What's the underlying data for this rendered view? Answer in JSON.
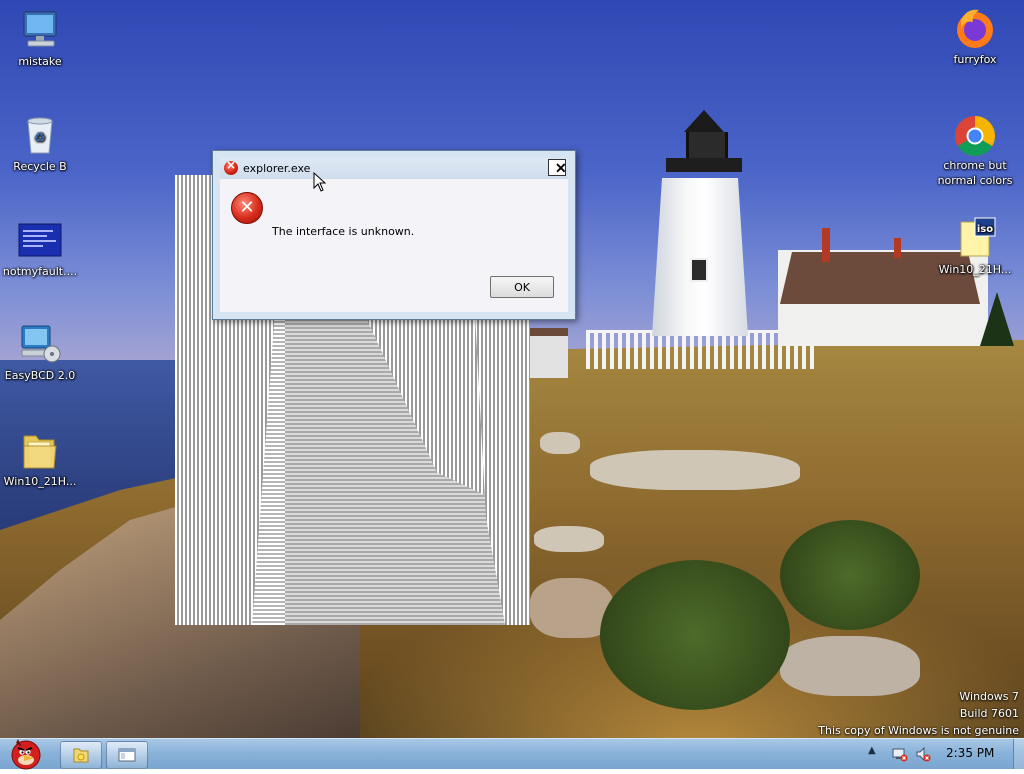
{
  "desktop": {
    "icons_left": [
      {
        "label": "mistake",
        "icon": "computer-icon"
      },
      {
        "label": "Recycle B",
        "icon": "recycle-bin-icon"
      },
      {
        "label": "notmyfault....",
        "icon": "bsod-thumbnail-icon"
      },
      {
        "label": "EasyBCD 2.0",
        "icon": "easybcd-icon"
      },
      {
        "label": "Win10_21H...",
        "icon": "folder-icon"
      }
    ],
    "icons_right": [
      {
        "label": "furryfox",
        "icon": "firefox-icon"
      },
      {
        "label": "chrome but\nnormal colors",
        "label_line1": "chrome but",
        "label_line2": "normal colors",
        "icon": "chrome-icon"
      },
      {
        "label": "Win10_21H...",
        "icon": "iso-file-icon",
        "badge": "iso"
      }
    ]
  },
  "dialog": {
    "title": "explorer.exe",
    "message": "The interface is unknown.",
    "ok_label": "OK",
    "close_glyph": "✕"
  },
  "watermark": {
    "line1": "Windows 7",
    "line2": "Build 7601",
    "line3": "This copy of Windows is not genuine"
  },
  "taskbar": {
    "clock": "2:35 PM",
    "pinned": [
      "explorer-folder-icon",
      "window-icon"
    ],
    "tray": [
      "show-hidden-icons-arrow",
      "network-error-icon",
      "volume-muted-icon"
    ],
    "tray_arrow": "▲"
  },
  "colors": {
    "taskbar": "#8ab3d9",
    "dialog_frame": "#d7e4f2",
    "error_red": "#d72b1b"
  }
}
